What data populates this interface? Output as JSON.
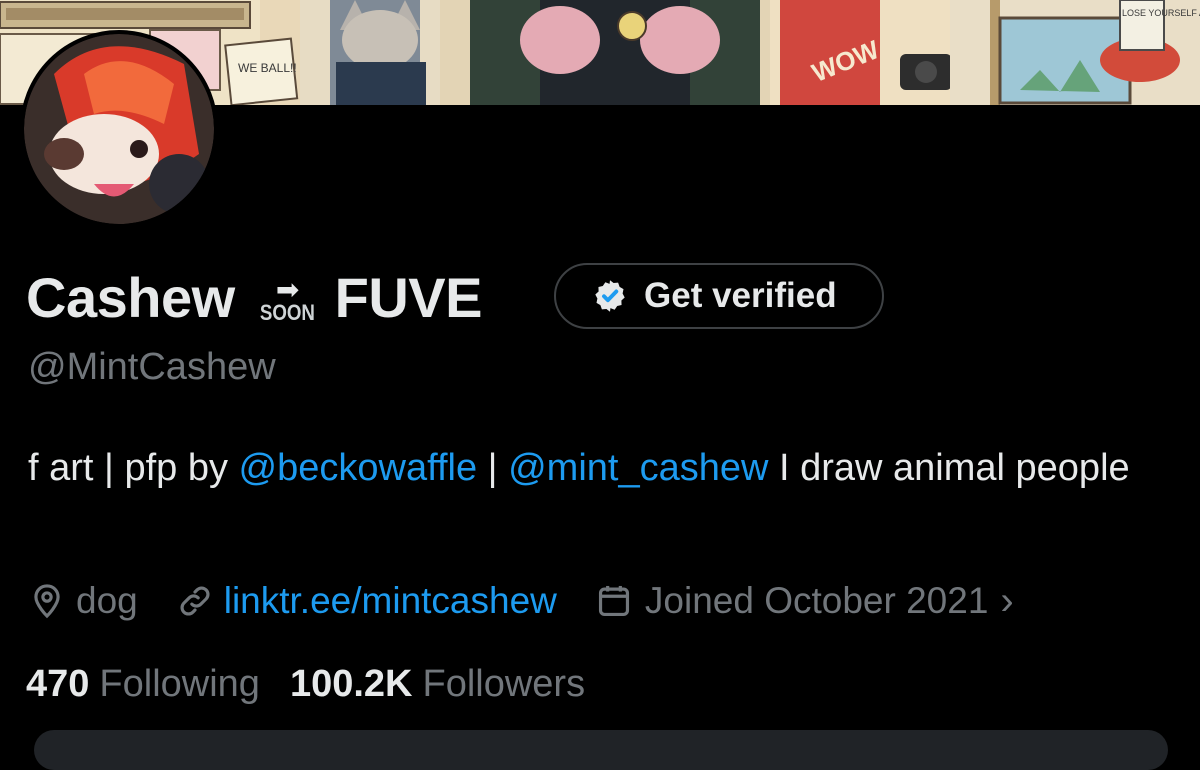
{
  "profile": {
    "name_part1": "Cashew",
    "name_emoji_text": "SOON",
    "name_part2": "FUVE",
    "handle": "@MintCashew",
    "verify_label": "Get verified",
    "bio": {
      "prefix": "f art | pfp by ",
      "mention1": "@beckowaffle",
      "separator": " | ",
      "mention2": "@mint_cashew",
      "suffix": " I draw animal people"
    },
    "location": "dog",
    "website": "linktr.ee/mintcashew",
    "joined": "Joined October 2021",
    "following_count": "470",
    "following_label": "Following",
    "followers_count": "100.2K",
    "followers_label": "Followers"
  },
  "banner_text": {
    "we_ball": "WE BALL!!",
    "wow": "WOW",
    "lose": "LOSE YOURSELF AGAIN"
  },
  "colors": {
    "accent": "#1d9bf0",
    "secondary_text": "#71767b",
    "primary_text": "#e7e9ea",
    "background": "#000000"
  },
  "icons": [
    "location-icon",
    "link-icon",
    "calendar-icon",
    "chevron-right-icon",
    "verified-badge-icon"
  ]
}
